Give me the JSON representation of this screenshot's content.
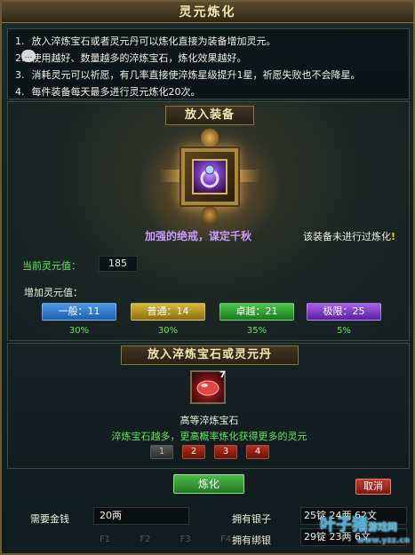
{
  "window": {
    "title": "灵元炼化"
  },
  "rules": [
    {
      "num": "1.",
      "text": "放入淬炼宝石或者灵元丹可以炼化直接为装备增加灵元。"
    },
    {
      "num": "2.",
      "text": "使用越好、数量越多的淬炼宝石，炼化效果越好。"
    },
    {
      "num": "3.",
      "text": "消耗灵元可以祈愿，有几率直接使淬炼星级提升1星，祈愿失败也不会降星。"
    },
    {
      "num": "4.",
      "text": "每件装备每天最多进行灵元炼化20次。"
    }
  ],
  "equip": {
    "header": "放入装备",
    "item_name": "加强的绝戒，谋定千秋",
    "status_text": "该装备未进行过炼化",
    "status_mark": "!",
    "current_label": "当前灵元值：",
    "current_value": "185",
    "add_label": "增加灵元值："
  },
  "levels": [
    {
      "label": "一般：11",
      "pct": "30%",
      "color": "#2f7fd8"
    },
    {
      "label": "普通：14",
      "pct": "30%",
      "color": "#b89a1c"
    },
    {
      "label": "卓越：21",
      "pct": "35%",
      "color": "#2fa82f"
    },
    {
      "label": "极限：25",
      "pct": "5%",
      "color": "#8a3fd0"
    }
  ],
  "stone": {
    "header": "放入淬炼宝石或灵元丹",
    "count": "7",
    "name": "高等淬炼宝石",
    "hint": "淬炼宝石越多，更高概率炼化获得更多的灵元",
    "qty_options": [
      "1",
      "2",
      "3",
      "4"
    ]
  },
  "actions": {
    "refine": "炼化",
    "cancel": "取消"
  },
  "money": {
    "need_label": "需要金钱",
    "need_value": "20两",
    "silver_label": "拥有银子",
    "silver_value": "25锭 24两 62文",
    "bound_label": "拥有绑银",
    "bound_value": "29锭 23两 6文"
  },
  "background": {
    "hotkeys": [
      "F1",
      "F2",
      "F3",
      "F4"
    ]
  },
  "watermark": {
    "main": "叶子猪",
    "sub": "游戏网",
    "url": "www.yzz.cn"
  }
}
